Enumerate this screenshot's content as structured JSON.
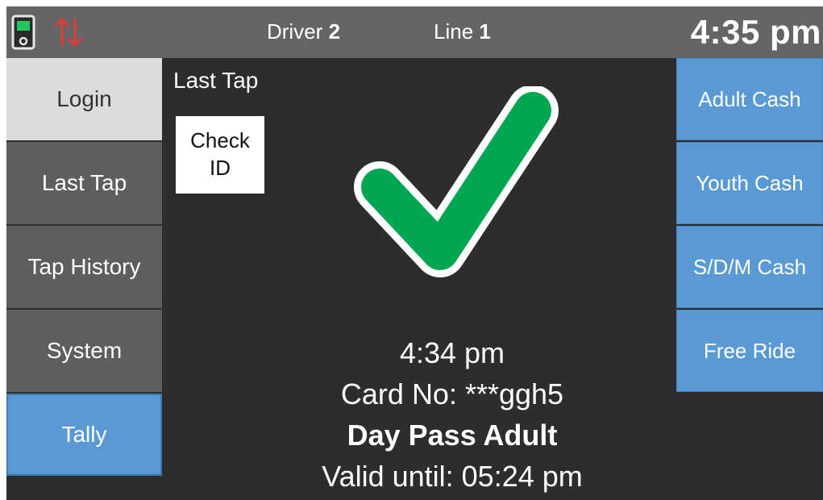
{
  "topbar": {
    "driver_label": "Driver",
    "driver_number": "2",
    "line_label": "Line",
    "line_number": "1",
    "time": "4:35 pm",
    "icons": [
      "card-reader-icon",
      "sync-arrows-icon"
    ],
    "sync_color": "#e53935"
  },
  "left_menu": {
    "items": [
      {
        "label": "Login"
      },
      {
        "label": "Last Tap"
      },
      {
        "label": "Tap History"
      },
      {
        "label": "System"
      },
      {
        "label": "Tally"
      }
    ]
  },
  "main": {
    "section_title": "Last Tap",
    "check_id_label": "Check ID",
    "result_icon": "checkmark-icon",
    "result_color": "#00a651",
    "tap_time": "4:34 pm",
    "card_number": "Card No: ***ggh5",
    "pass_type": "Day Pass Adult",
    "valid_until": "Valid until: 05:24 pm"
  },
  "right_menu": {
    "items": [
      {
        "label": "Adult Cash"
      },
      {
        "label": "Youth Cash"
      },
      {
        "label": "S/D/M Cash"
      },
      {
        "label": "Free Ride"
      }
    ]
  },
  "colors": {
    "background": "#2b2d2e",
    "topbar": "#636566",
    "menu_button": "#5c5e5f",
    "menu_button_active": "#dcdcdc",
    "accent_blue": "#5a9ad4"
  }
}
